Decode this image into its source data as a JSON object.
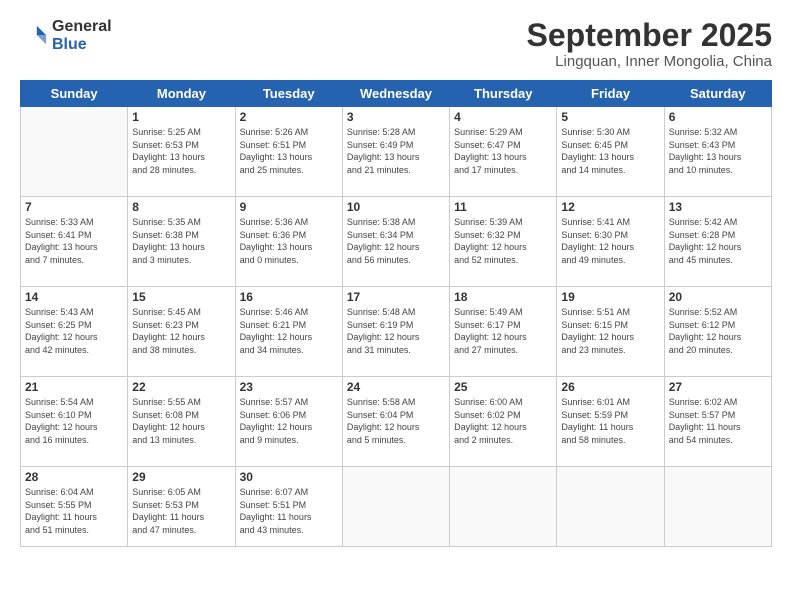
{
  "header": {
    "logo_general": "General",
    "logo_blue": "Blue",
    "title": "September 2025",
    "subtitle": "Lingquan, Inner Mongolia, China"
  },
  "days": [
    "Sunday",
    "Monday",
    "Tuesday",
    "Wednesday",
    "Thursday",
    "Friday",
    "Saturday"
  ],
  "weeks": [
    [
      {
        "date": "",
        "info": ""
      },
      {
        "date": "1",
        "info": "Sunrise: 5:25 AM\nSunset: 6:53 PM\nDaylight: 13 hours\nand 28 minutes."
      },
      {
        "date": "2",
        "info": "Sunrise: 5:26 AM\nSunset: 6:51 PM\nDaylight: 13 hours\nand 25 minutes."
      },
      {
        "date": "3",
        "info": "Sunrise: 5:28 AM\nSunset: 6:49 PM\nDaylight: 13 hours\nand 21 minutes."
      },
      {
        "date": "4",
        "info": "Sunrise: 5:29 AM\nSunset: 6:47 PM\nDaylight: 13 hours\nand 17 minutes."
      },
      {
        "date": "5",
        "info": "Sunrise: 5:30 AM\nSunset: 6:45 PM\nDaylight: 13 hours\nand 14 minutes."
      },
      {
        "date": "6",
        "info": "Sunrise: 5:32 AM\nSunset: 6:43 PM\nDaylight: 13 hours\nand 10 minutes."
      }
    ],
    [
      {
        "date": "7",
        "info": "Sunrise: 5:33 AM\nSunset: 6:41 PM\nDaylight: 13 hours\nand 7 minutes."
      },
      {
        "date": "8",
        "info": "Sunrise: 5:35 AM\nSunset: 6:38 PM\nDaylight: 13 hours\nand 3 minutes."
      },
      {
        "date": "9",
        "info": "Sunrise: 5:36 AM\nSunset: 6:36 PM\nDaylight: 13 hours\nand 0 minutes."
      },
      {
        "date": "10",
        "info": "Sunrise: 5:38 AM\nSunset: 6:34 PM\nDaylight: 12 hours\nand 56 minutes."
      },
      {
        "date": "11",
        "info": "Sunrise: 5:39 AM\nSunset: 6:32 PM\nDaylight: 12 hours\nand 52 minutes."
      },
      {
        "date": "12",
        "info": "Sunrise: 5:41 AM\nSunset: 6:30 PM\nDaylight: 12 hours\nand 49 minutes."
      },
      {
        "date": "13",
        "info": "Sunrise: 5:42 AM\nSunset: 6:28 PM\nDaylight: 12 hours\nand 45 minutes."
      }
    ],
    [
      {
        "date": "14",
        "info": "Sunrise: 5:43 AM\nSunset: 6:25 PM\nDaylight: 12 hours\nand 42 minutes."
      },
      {
        "date": "15",
        "info": "Sunrise: 5:45 AM\nSunset: 6:23 PM\nDaylight: 12 hours\nand 38 minutes."
      },
      {
        "date": "16",
        "info": "Sunrise: 5:46 AM\nSunset: 6:21 PM\nDaylight: 12 hours\nand 34 minutes."
      },
      {
        "date": "17",
        "info": "Sunrise: 5:48 AM\nSunset: 6:19 PM\nDaylight: 12 hours\nand 31 minutes."
      },
      {
        "date": "18",
        "info": "Sunrise: 5:49 AM\nSunset: 6:17 PM\nDaylight: 12 hours\nand 27 minutes."
      },
      {
        "date": "19",
        "info": "Sunrise: 5:51 AM\nSunset: 6:15 PM\nDaylight: 12 hours\nand 23 minutes."
      },
      {
        "date": "20",
        "info": "Sunrise: 5:52 AM\nSunset: 6:12 PM\nDaylight: 12 hours\nand 20 minutes."
      }
    ],
    [
      {
        "date": "21",
        "info": "Sunrise: 5:54 AM\nSunset: 6:10 PM\nDaylight: 12 hours\nand 16 minutes."
      },
      {
        "date": "22",
        "info": "Sunrise: 5:55 AM\nSunset: 6:08 PM\nDaylight: 12 hours\nand 13 minutes."
      },
      {
        "date": "23",
        "info": "Sunrise: 5:57 AM\nSunset: 6:06 PM\nDaylight: 12 hours\nand 9 minutes."
      },
      {
        "date": "24",
        "info": "Sunrise: 5:58 AM\nSunset: 6:04 PM\nDaylight: 12 hours\nand 5 minutes."
      },
      {
        "date": "25",
        "info": "Sunrise: 6:00 AM\nSunset: 6:02 PM\nDaylight: 12 hours\nand 2 minutes."
      },
      {
        "date": "26",
        "info": "Sunrise: 6:01 AM\nSunset: 5:59 PM\nDaylight: 11 hours\nand 58 minutes."
      },
      {
        "date": "27",
        "info": "Sunrise: 6:02 AM\nSunset: 5:57 PM\nDaylight: 11 hours\nand 54 minutes."
      }
    ],
    [
      {
        "date": "28",
        "info": "Sunrise: 6:04 AM\nSunset: 5:55 PM\nDaylight: 11 hours\nand 51 minutes."
      },
      {
        "date": "29",
        "info": "Sunrise: 6:05 AM\nSunset: 5:53 PM\nDaylight: 11 hours\nand 47 minutes."
      },
      {
        "date": "30",
        "info": "Sunrise: 6:07 AM\nSunset: 5:51 PM\nDaylight: 11 hours\nand 43 minutes."
      },
      {
        "date": "",
        "info": ""
      },
      {
        "date": "",
        "info": ""
      },
      {
        "date": "",
        "info": ""
      },
      {
        "date": "",
        "info": ""
      }
    ]
  ]
}
